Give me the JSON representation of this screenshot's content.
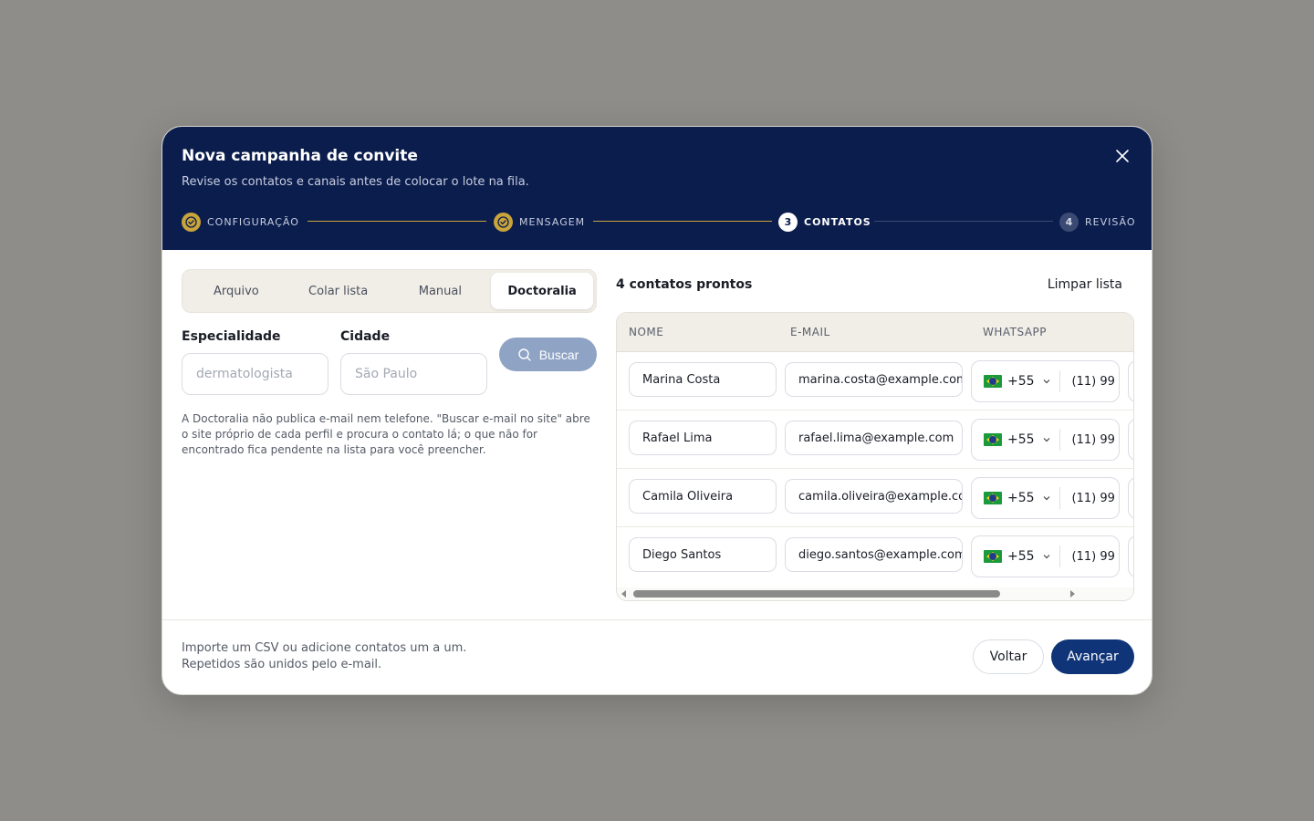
{
  "header": {
    "title": "Nova campanha de convite",
    "subtitle": "Revise os contatos e canais antes de colocar o lote na fila.",
    "steps": [
      {
        "number": "",
        "label": "CONFIGURAÇÃO",
        "state": "done"
      },
      {
        "number": "",
        "label": "MENSAGEM",
        "state": "done"
      },
      {
        "number": "3",
        "label": "CONTATOS",
        "state": "active"
      },
      {
        "number": "4",
        "label": "REVISÃO",
        "state": "pending"
      }
    ]
  },
  "tabs": [
    {
      "label": "Arquivo",
      "active": false
    },
    {
      "label": "Colar lista",
      "active": false
    },
    {
      "label": "Manual",
      "active": false
    },
    {
      "label": "Doctoralia",
      "active": true
    }
  ],
  "search": {
    "specialty_label": "Especialidade",
    "specialty_placeholder": "dermatologista",
    "city_label": "Cidade",
    "city_placeholder": "São Paulo",
    "button_label": "Buscar",
    "help_text": "A Doctoralia não publica e-mail nem telefone. \"Buscar e-mail no site\" abre o site próprio de cada perfil e procura o contato lá; o que não for encontrado fica pendente na lista para você preencher."
  },
  "contacts": {
    "count_label": "4 contatos prontos",
    "clear_label": "Limpar lista",
    "columns": [
      "NOME",
      "E-MAIL",
      "WHATSAPP"
    ],
    "rows": [
      {
        "name": "Marina Costa",
        "email": "marina.costa@example.com",
        "country_code": "+55",
        "phone": "(11) 99"
      },
      {
        "name": "Rafael Lima",
        "email": "rafael.lima@example.com",
        "country_code": "+55",
        "phone": "(11) 99"
      },
      {
        "name": "Camila Oliveira",
        "email": "camila.oliveira@example.com",
        "country_code": "+55",
        "phone": "(11) 99"
      },
      {
        "name": "Diego Santos",
        "email": "diego.santos@example.com",
        "country_code": "+55",
        "phone": "(11) 99"
      }
    ]
  },
  "footer": {
    "hint": "Importe um CSV ou adicione contatos um a um. Repetidos são unidos pelo e-mail.",
    "back_label": "Voltar",
    "next_label": "Avançar"
  },
  "colors": {
    "header_bg": "#0b1d4d",
    "accent_gold": "#c9a43a",
    "primary_button": "#0f3478"
  }
}
